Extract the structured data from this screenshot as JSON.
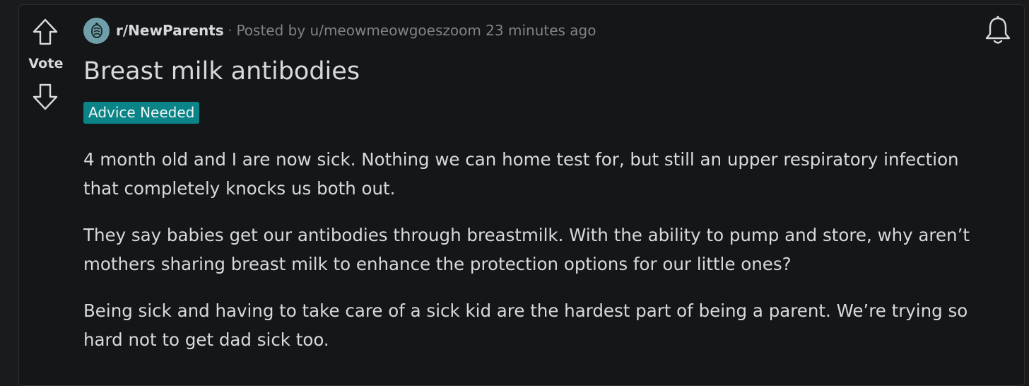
{
  "vote": {
    "label": "Vote",
    "upvote_icon": "arrow-up-outline-icon",
    "downvote_icon": "arrow-down-outline-icon"
  },
  "post": {
    "subreddit": "r/NewParents",
    "separator": "·",
    "posted_by": "Posted by u/meowmeowgoeszoom 23 minutes ago",
    "title": "Breast milk antibodies",
    "flair": "Advice Needed",
    "paragraphs": [
      "4 month old and I are now sick. Nothing we can home test for, but still an upper respiratory infection that completely knocks us both out.",
      "They say babies get our antibodies through breastmilk. With the ability to pump and store, why aren’t mothers sharing breast milk to enhance the protection options for our little ones?",
      "Being sick and having to take care of a sick kid are the hardest part of being a parent. We’re trying so hard not to get dad sick too."
    ]
  },
  "icons": {
    "subreddit_avatar": "subreddit-avatar-icon",
    "notification": "bell-icon"
  },
  "colors": {
    "background": "#141617",
    "text": "#d7dadc",
    "muted": "#818384",
    "flair": "#0a8487",
    "avatar": "#6f9fa9"
  }
}
